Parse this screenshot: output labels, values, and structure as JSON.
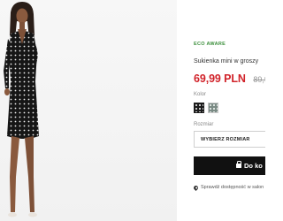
{
  "product": {
    "eco_label": "ECO AWARE",
    "name": "Sukienka mini w groszy",
    "price_current": "69,99 PLN",
    "price_old": "89,99"
  },
  "colors": {
    "label": "Kolor",
    "swatches": [
      {
        "name": "black-polka-dot",
        "selected": true
      },
      {
        "name": "light-pattern",
        "selected": false
      }
    ]
  },
  "sizes": {
    "label": "Rozmiar",
    "select_placeholder": "WYBIERZ ROZMIAR"
  },
  "cart": {
    "add_label": "Do ko",
    "icon": "shopping-bag-icon"
  },
  "store": {
    "icon": "location-pin-icon",
    "text": "Sprawdź dostępność w salon"
  },
  "theme": {
    "price_color": "#d1232a",
    "eco_color": "#3c8f3c",
    "button_color": "#111111"
  }
}
